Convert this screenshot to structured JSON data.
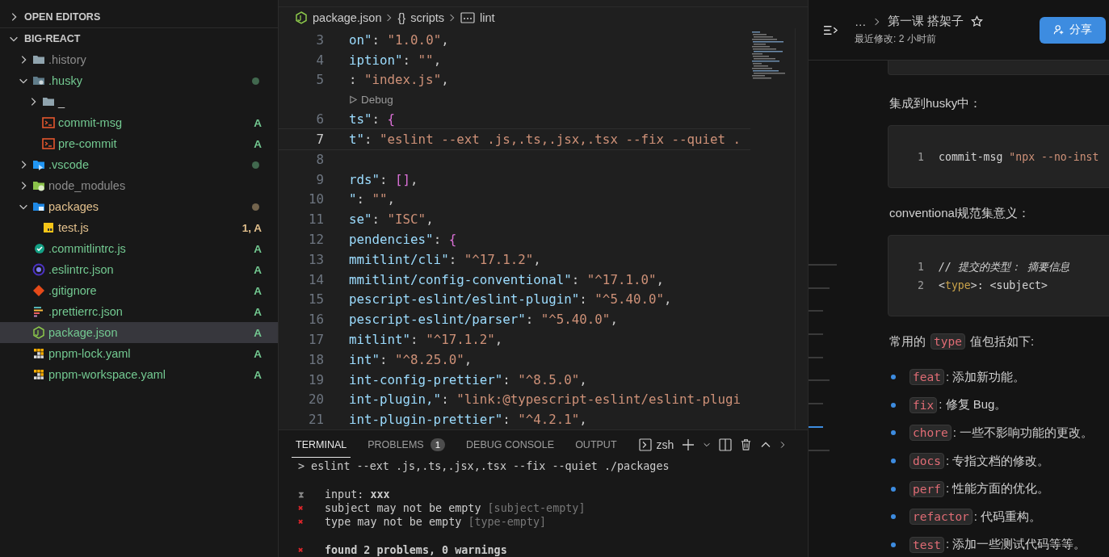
{
  "explorer": {
    "sections": [
      {
        "title": "OPEN EDITORS",
        "expanded": false
      },
      {
        "title": "BIG-REACT",
        "expanded": true
      }
    ],
    "tree": [
      {
        "name": ".history",
        "kind": "folder",
        "color": "#8c8c8c",
        "expanded": false,
        "selected": false
      },
      {
        "name": ".husky",
        "kind": "folder-husky",
        "color": "#73c991",
        "dot": true,
        "expanded": true,
        "selected": false,
        "children": [
          {
            "name": "_",
            "kind": "folder",
            "color": "#cccccc",
            "expanded": false,
            "selected": false
          },
          {
            "name": "commit-msg",
            "kind": "shell",
            "color": "#73c991",
            "badge": "A",
            "selected": false
          },
          {
            "name": "pre-commit",
            "kind": "shell",
            "color": "#73c991",
            "badge": "A",
            "selected": false
          }
        ]
      },
      {
        "name": ".vscode",
        "kind": "folder-vscode",
        "color": "#73c991",
        "dot": true,
        "expanded": false,
        "selected": false
      },
      {
        "name": "node_modules",
        "kind": "folder-node",
        "color": "#8c8c8c",
        "expanded": false,
        "selected": false
      },
      {
        "name": "packages",
        "kind": "folder-packages",
        "color": "#e2c08d",
        "dot": true,
        "expanded": true,
        "selected": false,
        "children": [
          {
            "name": "test.js",
            "kind": "js",
            "color": "#e2c08d",
            "badge": "1, A",
            "selected": false
          }
        ]
      },
      {
        "name": ".commitlintrc.js",
        "kind": "commitlint",
        "color": "#73c991",
        "badge": "A",
        "selected": false
      },
      {
        "name": ".eslintrc.json",
        "kind": "eslint",
        "color": "#73c991",
        "badge": "A",
        "selected": false
      },
      {
        "name": ".gitignore",
        "kind": "git",
        "color": "#73c991",
        "badge": "A",
        "selected": false
      },
      {
        "name": ".prettierrc.json",
        "kind": "prettier",
        "color": "#73c991",
        "badge": "A",
        "selected": false
      },
      {
        "name": "package.json",
        "kind": "node-json",
        "color": "#73c991",
        "badge": "A",
        "selected": true
      },
      {
        "name": "pnpm-lock.yaml",
        "kind": "pnpm",
        "color": "#73c991",
        "badge": "A",
        "selected": false
      },
      {
        "name": "pnpm-workspace.yaml",
        "kind": "pnpm",
        "color": "#73c991",
        "badge": "A",
        "selected": false
      }
    ]
  },
  "editor": {
    "breadcrumb": [
      {
        "kind": "file",
        "text": "package.json"
      },
      {
        "kind": "object",
        "glyph": "{}",
        "text": "scripts"
      },
      {
        "kind": "string",
        "text": "lint"
      }
    ],
    "lines": [
      {
        "kind": "code",
        "number": "3",
        "current": false,
        "tokens": [
          {
            "kind": "key",
            "text": "on\""
          },
          {
            "kind": "punct",
            "text": ": "
          },
          {
            "kind": "string",
            "text": "\"1.0.0\""
          },
          {
            "kind": "punct",
            "text": ","
          }
        ]
      },
      {
        "kind": "code",
        "number": "4",
        "current": false,
        "tokens": [
          {
            "kind": "key",
            "text": "iption\""
          },
          {
            "kind": "punct",
            "text": ": "
          },
          {
            "kind": "string",
            "text": "\"\""
          },
          {
            "kind": "punct",
            "text": ","
          }
        ]
      },
      {
        "kind": "code",
        "number": "5",
        "current": false,
        "tokens": [
          {
            "kind": "punct",
            "text": ": "
          },
          {
            "kind": "string",
            "text": "\"index.js\""
          },
          {
            "kind": "punct",
            "text": ","
          }
        ]
      },
      {
        "kind": "codelens",
        "text": "Debug"
      },
      {
        "kind": "code",
        "number": "6",
        "current": false,
        "tokens": [
          {
            "kind": "key",
            "text": "ts\""
          },
          {
            "kind": "punct",
            "text": ": "
          },
          {
            "kind": "bracket",
            "text": "{"
          }
        ]
      },
      {
        "kind": "code",
        "number": "7",
        "current": true,
        "tokens": [
          {
            "kind": "key",
            "text": "t\""
          },
          {
            "kind": "punct",
            "text": ": "
          },
          {
            "kind": "string",
            "text": "\"eslint --ext .js,.ts,.jsx,.tsx --fix --quiet ."
          }
        ]
      },
      {
        "kind": "code",
        "number": "8",
        "current": false
      },
      {
        "kind": "code",
        "number": "9",
        "current": false,
        "tokens": [
          {
            "kind": "key",
            "text": "rds\""
          },
          {
            "kind": "punct",
            "text": ": "
          },
          {
            "kind": "bracket",
            "text": "[]"
          },
          {
            "kind": "punct",
            "text": ","
          }
        ]
      },
      {
        "kind": "code",
        "number": "10",
        "current": false,
        "tokens": [
          {
            "kind": "key",
            "text": "\""
          },
          {
            "kind": "punct",
            "text": ": "
          },
          {
            "kind": "string",
            "text": "\"\""
          },
          {
            "kind": "punct",
            "text": ","
          }
        ]
      },
      {
        "kind": "code",
        "number": "11",
        "current": false,
        "tokens": [
          {
            "kind": "key",
            "text": "se\""
          },
          {
            "kind": "punct",
            "text": ": "
          },
          {
            "kind": "string",
            "text": "\"ISC\""
          },
          {
            "kind": "punct",
            "text": ","
          }
        ]
      },
      {
        "kind": "code",
        "number": "12",
        "current": false,
        "tokens": [
          {
            "kind": "key",
            "text": "pendencies\""
          },
          {
            "kind": "punct",
            "text": ": "
          },
          {
            "kind": "bracket",
            "text": "{"
          }
        ]
      },
      {
        "kind": "code",
        "number": "13",
        "current": false,
        "tokens": [
          {
            "kind": "key",
            "text": "mmitlint/cli\""
          },
          {
            "kind": "punct",
            "text": ": "
          },
          {
            "kind": "string",
            "text": "\"^17.1.2\""
          },
          {
            "kind": "punct",
            "text": ","
          }
        ]
      },
      {
        "kind": "code",
        "number": "14",
        "current": false,
        "tokens": [
          {
            "kind": "key",
            "text": "mmitlint/config-conventional\""
          },
          {
            "kind": "punct",
            "text": ": "
          },
          {
            "kind": "string",
            "text": "\"^17.1.0\""
          },
          {
            "kind": "punct",
            "text": ","
          }
        ]
      },
      {
        "kind": "code",
        "number": "15",
        "current": false,
        "tokens": [
          {
            "kind": "key",
            "text": "pescript-eslint/eslint-plugin\""
          },
          {
            "kind": "punct",
            "text": ": "
          },
          {
            "kind": "string",
            "text": "\"^5.40.0\""
          },
          {
            "kind": "punct",
            "text": ","
          }
        ]
      },
      {
        "kind": "code",
        "number": "16",
        "current": false,
        "tokens": [
          {
            "kind": "key",
            "text": "pescript-eslint/parser\""
          },
          {
            "kind": "punct",
            "text": ": "
          },
          {
            "kind": "string",
            "text": "\"^5.40.0\""
          },
          {
            "kind": "punct",
            "text": ","
          }
        ]
      },
      {
        "kind": "code",
        "number": "17",
        "current": false,
        "tokens": [
          {
            "kind": "key",
            "text": "mitlint\""
          },
          {
            "kind": "punct",
            "text": ": "
          },
          {
            "kind": "string",
            "text": "\"^17.1.2\""
          },
          {
            "kind": "punct",
            "text": ","
          }
        ]
      },
      {
        "kind": "code",
        "number": "18",
        "current": false,
        "tokens": [
          {
            "kind": "key",
            "text": "int\""
          },
          {
            "kind": "punct",
            "text": ": "
          },
          {
            "kind": "string",
            "text": "\"^8.25.0\""
          },
          {
            "kind": "punct",
            "text": ","
          }
        ]
      },
      {
        "kind": "code",
        "number": "19",
        "current": false,
        "tokens": [
          {
            "kind": "key",
            "text": "int-config-prettier\""
          },
          {
            "kind": "punct",
            "text": ": "
          },
          {
            "kind": "string",
            "text": "\"^8.5.0\""
          },
          {
            "kind": "punct",
            "text": ","
          }
        ]
      },
      {
        "kind": "code",
        "number": "20",
        "current": false,
        "tokens": [
          {
            "kind": "key",
            "text": "int-plugin,\""
          },
          {
            "kind": "punct",
            "text": ": "
          },
          {
            "kind": "string",
            "text": "\"link:@typescript-eslint/eslint-plugi"
          }
        ]
      },
      {
        "kind": "code",
        "number": "21",
        "current": false,
        "tokens": [
          {
            "kind": "key",
            "text": "int-plugin-prettier\""
          },
          {
            "kind": "punct",
            "text": ": "
          },
          {
            "kind": "string",
            "text": "\"^4.2.1\""
          },
          {
            "kind": "punct",
            "text": ","
          }
        ]
      }
    ]
  },
  "panel": {
    "tabs": [
      {
        "label": "TERMINAL",
        "selected": true
      },
      {
        "label": "PROBLEMS",
        "count": "1",
        "selected": false
      },
      {
        "label": "DEBUG CONSOLE",
        "selected": false
      },
      {
        "label": "OUTPUT",
        "selected": false
      }
    ],
    "shell": "zsh",
    "lines": [
      {
        "kind": "command",
        "text": "> eslint --ext .js,.ts,.jsx,.tsx --fix --quiet ./packages"
      },
      {
        "kind": "blank"
      },
      {
        "kind": "info",
        "mark": "⧗",
        "text": "input: **xxx**",
        "bold": false
      },
      {
        "kind": "error",
        "mark": "✖",
        "text": "subject may not be empty",
        "hint": "[subject-empty]",
        "bold": false
      },
      {
        "kind": "error",
        "mark": "✖",
        "text": "type may not be empty",
        "hint": "[type-empty]",
        "bold": false
      },
      {
        "kind": "blank"
      },
      {
        "kind": "error",
        "mark": "✖",
        "text": "found 2 problems, 0 warnings",
        "bold": true
      }
    ]
  },
  "doc": {
    "more": "…",
    "title": "第一课 搭架子",
    "starred": false,
    "modified": "最近修改: 2 小时前",
    "share": "分享",
    "outline": [
      {
        "selected": false
      },
      {
        "selected": false
      },
      {
        "selected": false
      },
      {
        "selected": false
      },
      {
        "selected": false
      },
      {
        "selected": false
      },
      {
        "selected": false
      },
      {
        "selected": true
      },
      {
        "selected": false
      }
    ],
    "blocks": [
      {
        "kind": "code-tail"
      },
      {
        "kind": "paragraph",
        "parts": [
          {
            "kind": "text",
            "text": "集成到husky中："
          }
        ]
      },
      {
        "kind": "code",
        "lines": [
          {
            "number": "1",
            "tokens": [
              {
                "kind": "plain",
                "text": "commit-msg "
              },
              {
                "kind": "string",
                "text": "\"npx --no-inst"
              }
            ]
          }
        ]
      },
      {
        "kind": "paragraph",
        "parts": [
          {
            "kind": "text",
            "text": "conventional规范集意义："
          }
        ]
      },
      {
        "kind": "code",
        "lines": [
          {
            "number": "1",
            "tokens": [
              {
                "kind": "comment",
                "text": "// 提交的类型： 摘要信息"
              }
            ]
          },
          {
            "number": "2",
            "tokens": [
              {
                "kind": "plain",
                "text": "<"
              },
              {
                "kind": "type",
                "text": "type"
              },
              {
                "kind": "plain",
                "text": ">: <subject>"
              }
            ]
          }
        ]
      },
      {
        "kind": "paragraph",
        "parts": [
          {
            "kind": "text",
            "text": "常用的"
          },
          {
            "kind": "code",
            "text": "type"
          },
          {
            "kind": "text",
            "text": "值包括如下:"
          }
        ]
      },
      {
        "kind": "list",
        "items": [
          {
            "code": "feat",
            "text": ": 添加新功能。"
          },
          {
            "code": "fix",
            "text": ": 修复 Bug。"
          },
          {
            "code": "chore",
            "text": ": 一些不影响功能的更改。"
          },
          {
            "code": "docs",
            "text": ": 专指文档的修改。"
          },
          {
            "code": "perf",
            "text": ": 性能方面的优化。"
          },
          {
            "code": "refactor",
            "text": ": 代码重构。"
          },
          {
            "code": "test",
            "text": ": 添加一些测试代码等等。"
          }
        ]
      }
    ]
  }
}
